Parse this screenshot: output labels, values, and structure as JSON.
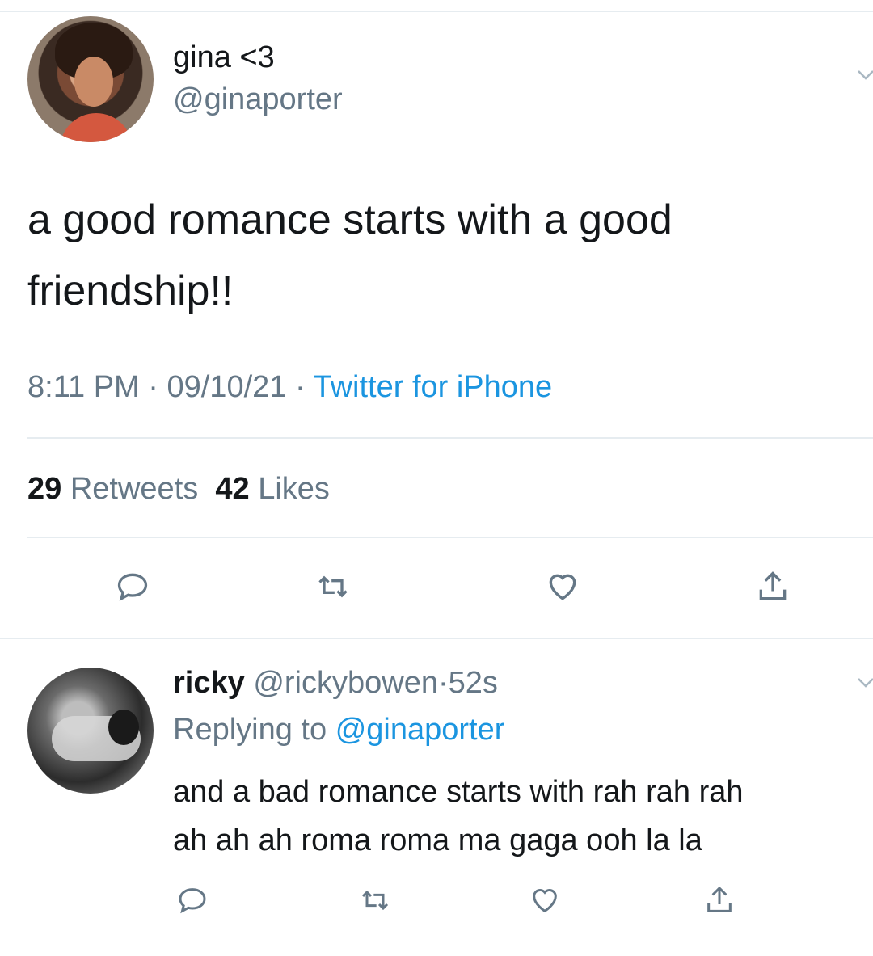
{
  "main_tweet": {
    "display_name": "gina <3",
    "handle": "@ginaporter",
    "text_line1": "a good romance starts with a good",
    "text_line2": "friendship!!",
    "time": "8:11 PM",
    "separator": "·",
    "date": "09/10/21",
    "source": "Twitter for iPhone",
    "retweets_count": "29",
    "retweets_label": "Retweets",
    "likes_count": "42",
    "likes_label": "Likes",
    "actions": [
      "reply-icon",
      "retweet-icon",
      "like-icon",
      "share-icon"
    ]
  },
  "reply": {
    "display_name": "ricky",
    "handle": "@rickybowen",
    "separator": "·",
    "time": "52s",
    "replying_prefix": "Replying to",
    "replying_to": "@ginaporter",
    "text_line1": "and a bad romance starts with rah rah rah",
    "text_line2": "ah ah ah roma roma ma gaga ooh la la",
    "actions": [
      "reply-icon",
      "retweet-icon",
      "like-icon",
      "share-icon"
    ]
  },
  "colors": {
    "text": "#14171a",
    "secondary": "#657786",
    "link": "#1b95e0",
    "divider": "#e6ecf0"
  }
}
